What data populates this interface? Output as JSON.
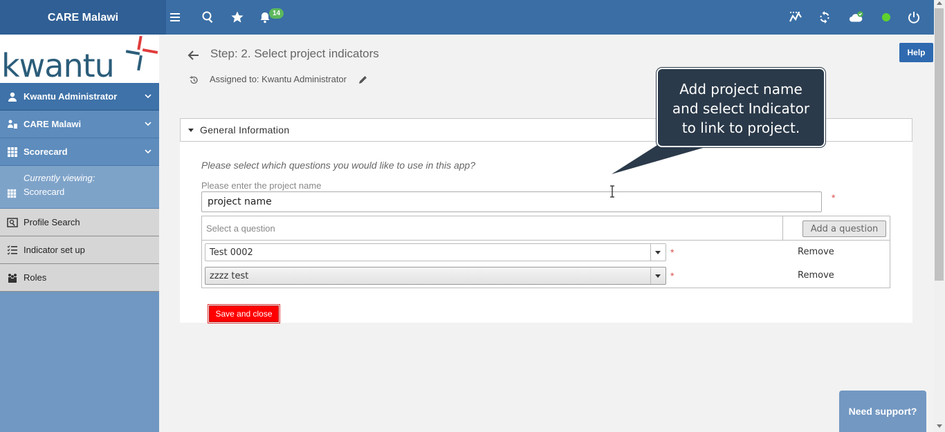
{
  "app": {
    "brand": "CARE Malawi",
    "notification_count": "14"
  },
  "topbar_icons": [
    "menu-icon",
    "search-icon",
    "star-icon",
    "bell-icon",
    "chart-icon",
    "sync-icon",
    "cloud-check-icon",
    "status-dot",
    "power-icon"
  ],
  "logo": {
    "text": "kwantu"
  },
  "sidebar": {
    "user": "Kwantu Administrator",
    "org": "CARE Malawi",
    "app": "Scorecard",
    "currently_viewing_label": "Currently viewing:",
    "currently_viewing_value": "Scorecard",
    "items": [
      {
        "label": "Profile Search",
        "icon": "profile-search-icon"
      },
      {
        "label": "Indicator set up",
        "icon": "checklist-icon"
      },
      {
        "label": "Roles",
        "icon": "people-icon"
      }
    ]
  },
  "header": {
    "title": "Step: 2. Select project indicators",
    "assigned": "Assigned to: Kwantu Administrator",
    "help_label": "Help"
  },
  "panel": {
    "title": "General Information",
    "instruction": "Please select which questions you would like to use in this app?",
    "name_label": "Please enter the project name",
    "name_value": "project name",
    "required_mark": "*",
    "select_placeholder": "Select a question",
    "add_question_label": "Add a question",
    "questions": [
      {
        "value": "Test 0002",
        "remove_label": "Remove"
      },
      {
        "value": "zzzz test",
        "remove_label": "Remove"
      }
    ],
    "save_label": "Save and close"
  },
  "tooltip": {
    "line1": "Add project name",
    "line2": "and select Indicator",
    "line3": "to link to project."
  },
  "support_label": "Need support?"
}
